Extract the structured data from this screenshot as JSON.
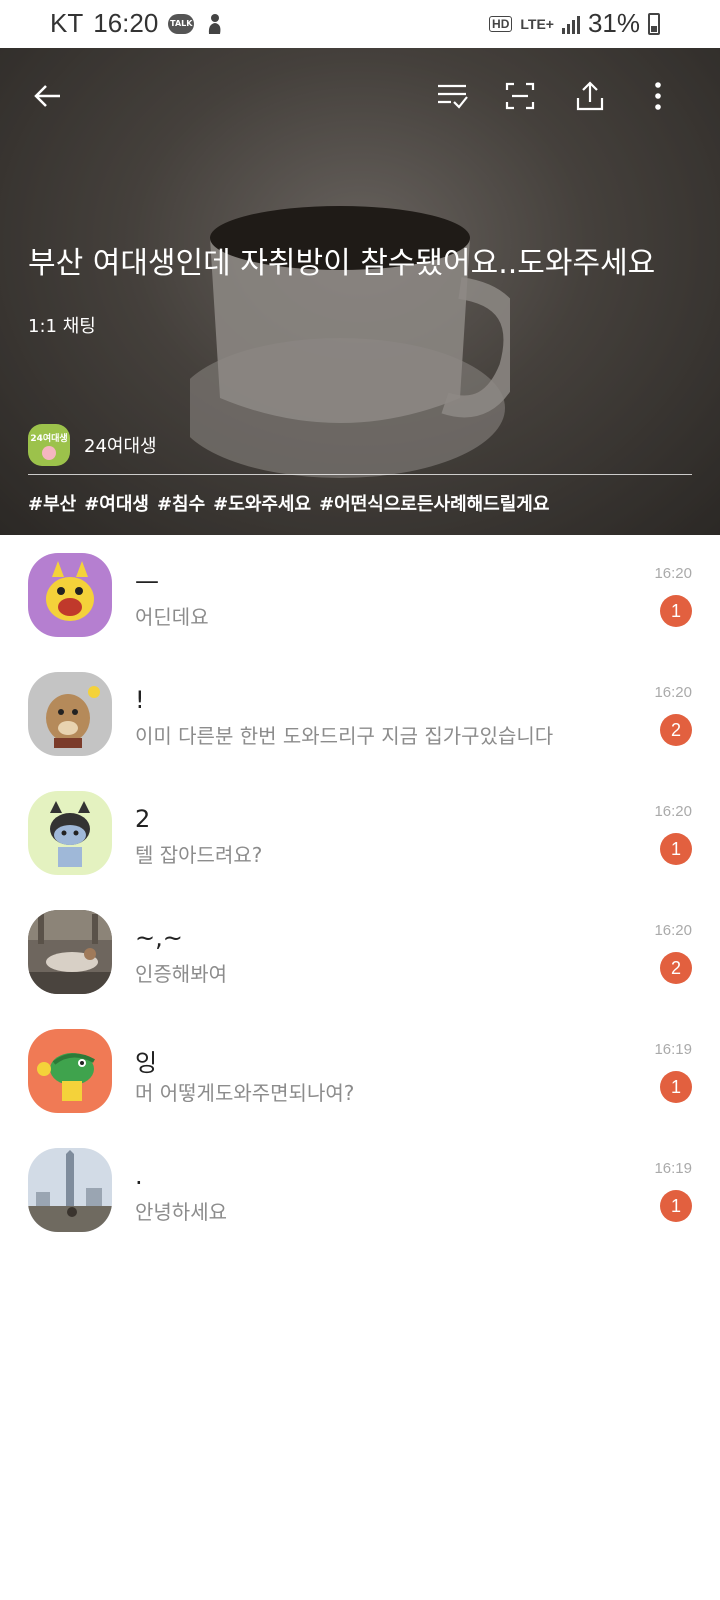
{
  "status_bar": {
    "carrier": "KT",
    "time": "16:20",
    "talk_badge": "TALK",
    "hd": "HD",
    "network": "LTE+",
    "battery": "31%"
  },
  "colors": {
    "badge": "#e2603f",
    "hero_overlay": "#3a3632"
  },
  "header": {
    "title": "부산 여대생인데 자취방이 참수됐어요..도와주세요",
    "chat_type": "1:1 채팅",
    "host": {
      "avatar_text": "24여대생",
      "name": "24여대생"
    },
    "tags": [
      "#부산",
      "#여대생",
      "#침수",
      "#도와주세요",
      "#어떤식으로든사례해드릴게요"
    ],
    "icons": [
      "back-arrow-icon",
      "checklist-icon",
      "scan-icon",
      "share-icon",
      "more-vertical-icon"
    ]
  },
  "chats": [
    {
      "name": "—",
      "message": "어딘데요",
      "time": "16:20",
      "unread": "1",
      "avatar": "yellow-character-avatar"
    },
    {
      "name": "!",
      "message": "이미 다른분 한번 도와드리구 지금 집가구있습니다",
      "time": "16:20",
      "unread": "2",
      "avatar": "dog-character-avatar"
    },
    {
      "name": "2",
      "message": "텔 잡아드려요?",
      "time": "16:20",
      "unread": "1",
      "avatar": "cat-character-avatar"
    },
    {
      "name": "~,~",
      "message": "인증해봐여",
      "time": "16:20",
      "unread": "2",
      "avatar": "photo-avatar"
    },
    {
      "name": "잉",
      "message": "머 어떻게도와주면되나여?",
      "time": "16:19",
      "unread": "1",
      "avatar": "crocodile-character-avatar"
    },
    {
      "name": ".",
      "message": "안녕하세요",
      "time": "16:19",
      "unread": "1",
      "avatar": "city-photo-avatar"
    }
  ]
}
